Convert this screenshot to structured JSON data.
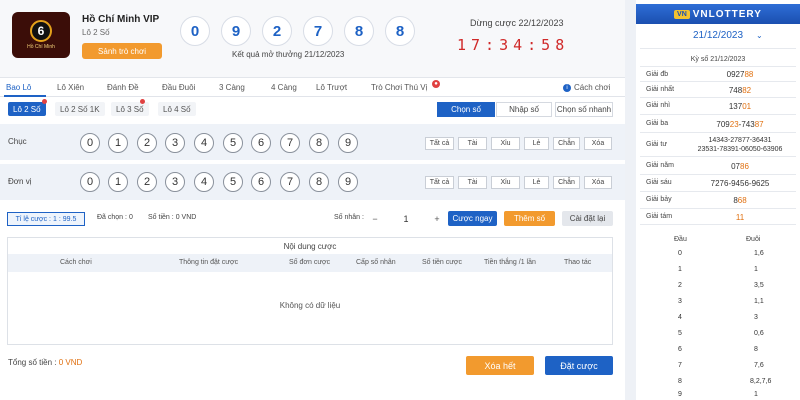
{
  "game": {
    "logo_icon": "lottery-ball-logo",
    "logo_number": "6",
    "logo_caption": "Hồ Chí Minh",
    "name": "Hồ Chí Minh VIP",
    "subtitle": "Lô 2 Số",
    "lobby_button": "Sảnh trò chơi"
  },
  "result": {
    "balls": [
      "0",
      "9",
      "2",
      "7",
      "8",
      "8"
    ],
    "date_label": "Kết quả mở thưởng 21/12/2023"
  },
  "countdown": {
    "label": "Dừng cược 22/12/2023",
    "time": "17:34:58"
  },
  "tabs": [
    "Bao Lô",
    "Lô Xiên",
    "Đánh Đề",
    "Đầu Đuôi",
    "3 Càng",
    "4 Càng",
    "Lô Trượt",
    "Trò Chơi Thú Vị"
  ],
  "active_tab": "Bao Lô",
  "howto": {
    "label": "Cách chơi",
    "icon": "info-icon"
  },
  "subtabs": [
    "Lô 2 Số",
    "Lô 2 Số 1K",
    "Lô 3 Số",
    "Lô 4 Số"
  ],
  "modes": [
    "Chọn số",
    "Nhập số",
    "Chọn số nhanh"
  ],
  "rows": [
    {
      "label": "Chục"
    },
    {
      "label": "Đơn vị"
    }
  ],
  "digits": [
    "0",
    "1",
    "2",
    "3",
    "4",
    "5",
    "6",
    "7",
    "8",
    "9"
  ],
  "quick_buttons": [
    "Tất cả",
    "Tài",
    "Xỉu",
    "Lẻ",
    "Chẵn",
    "Xóa"
  ],
  "bet": {
    "rate_label": "Tỉ lệ cược :",
    "rate_value": "1 : 99.5",
    "selected_label": "Đã chọn :",
    "selected_value": "0",
    "amount_label": "Số tiền :",
    "amount_value": "0 VND",
    "multiplier_label": "Số nhân :",
    "multiplier_value": "1",
    "minus": "−",
    "plus": "+",
    "bet_now": "Cược ngay",
    "add_number": "Thêm số",
    "reset": "Cài đặt lại"
  },
  "table": {
    "title": "Nội dung cược",
    "headers": [
      "Cách chơi",
      "Thông tin đặt cược",
      "Số đơn cược",
      "Cấp số nhân",
      "Số tiền cược",
      "Tiền thắng /1 lần",
      "Thao tác"
    ],
    "empty_text": "Không có dữ liệu"
  },
  "footer": {
    "total_label": "Tổng số tiền :",
    "total_value": "0 VND",
    "clear_all": "Xóa hết",
    "place_bet": "Đặt cược"
  },
  "colors": {
    "primary": "#1e62c5",
    "orange": "#f29a2e",
    "red": "#d02a2a",
    "highlight": "#e07010"
  },
  "panel": {
    "brand": "VNLOTTERY",
    "brand_logo": "VN",
    "date": "21/12/2023",
    "chevron_icon": "chevron-down-icon",
    "draw_label": "Kỳ số 21/12/2023",
    "prizes": [
      {
        "name": "Giải đb",
        "pre": "0927",
        "hl": "88"
      },
      {
        "name": "Giải nhất",
        "pre": "748",
        "hl": "82"
      },
      {
        "name": "Giải nhì",
        "pre": "137",
        "hl": "01"
      },
      {
        "name": "Giải ba",
        "pre": "709",
        "hl": "23",
        "pre2": "-743",
        "hl2": "87"
      },
      {
        "name": "Giải tư",
        "line1": "14343-27877-36431",
        "line2": "23531-78391-06050-63906"
      },
      {
        "name": "Giải năm",
        "pre": "07",
        "hl": "86"
      },
      {
        "name": "Giải sáu",
        "text": "7276-9456-9625"
      },
      {
        "name": "Giải bảy",
        "pre": "8",
        "hl": "68"
      },
      {
        "name": "Giải tám",
        "hl": "11"
      }
    ],
    "head_label": "Đầu",
    "tail_label": "Đuôi",
    "head_tail": [
      {
        "h": "0",
        "t": "1,6"
      },
      {
        "h": "1",
        "t": "1"
      },
      {
        "h": "2",
        "t": "3,5"
      },
      {
        "h": "3",
        "t": "1,1"
      },
      {
        "h": "4",
        "t": "3"
      },
      {
        "h": "5",
        "t": "0,6"
      },
      {
        "h": "6",
        "t": "8"
      },
      {
        "h": "7",
        "t": "7,6"
      },
      {
        "h": "8",
        "t": "8,2,7,6"
      },
      {
        "h": "9",
        "t": "1"
      }
    ]
  }
}
